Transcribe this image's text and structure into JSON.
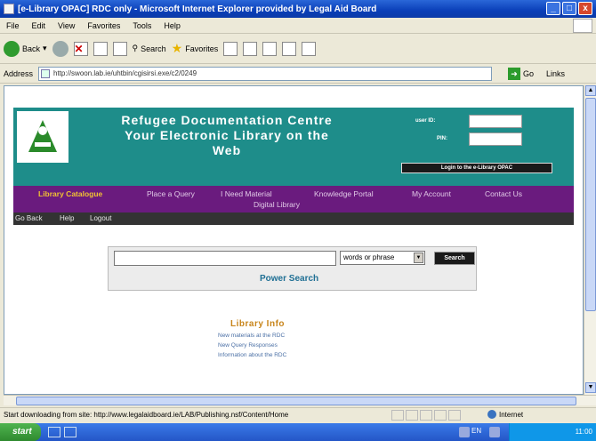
{
  "window": {
    "title": "[e-Library OPAC] RDC only - Microsoft Internet Explorer provided by Legal Aid Board",
    "min": "_",
    "max": "□",
    "close": "x"
  },
  "menubar": [
    "File",
    "Edit",
    "View",
    "Favorites",
    "Tools",
    "Help"
  ],
  "toolbar": {
    "back": "Back",
    "search": "Search",
    "favorites": "Favorites"
  },
  "address": {
    "label": "Address",
    "url": "http://swoon.lab.ie/uhtbin/cgisirsi.exe/c2/0249",
    "go": "Go",
    "links": "Links"
  },
  "site": {
    "title_line1": "Refugee Documentation Centre",
    "title_line2": "Your Electronic Library on the",
    "title_line3": "Web",
    "user_id_label": "user ID:",
    "pin_label": "PIN:",
    "login_button": "Login to the e-Library OPAC",
    "nav": {
      "library_catalogue": "Library Catalogue",
      "place_query": "Place a Query",
      "need_material": "I Need Material",
      "knowledge_portal": "Knowledge Portal",
      "my_account": "My Account",
      "contact_us": "Contact Us",
      "digital_library": "Digital Library"
    },
    "subnav": {
      "go_back": "Go Back",
      "help": "Help",
      "logout": "Logout"
    },
    "search": {
      "select_value": "words or phrase",
      "button": "Search",
      "power_search": "Power Search"
    },
    "library_info": {
      "heading": "Library Info",
      "links": [
        "New materials at the RDC",
        "New Query Responses",
        "Information about the RDC"
      ]
    }
  },
  "status": {
    "text": "Start downloading from site: http://www.legalaidboard.ie/LAB/Publishing.nsf/Content/Home",
    "zone": "Internet"
  },
  "taskbar": {
    "start": "start",
    "lang": "EN",
    "time": "11:00"
  }
}
